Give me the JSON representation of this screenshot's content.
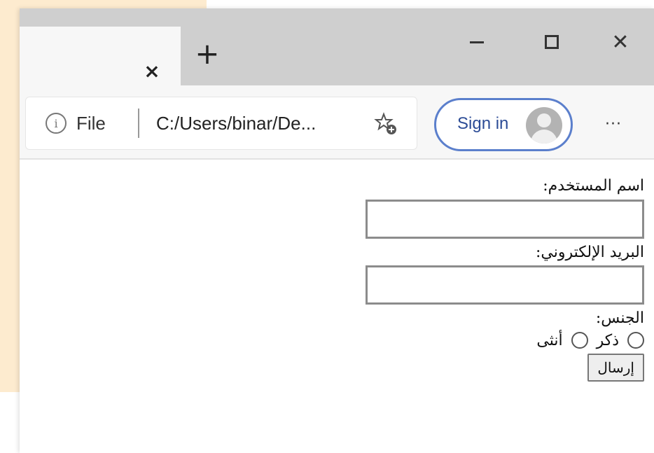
{
  "browser": {
    "tab": {
      "close_glyph": "×"
    },
    "new_tab_glyph": "+",
    "window_controls": {
      "minimize": "minimize-icon",
      "maximize": "maximize-icon",
      "close_glyph": "✕"
    },
    "address_bar": {
      "info_glyph": "i",
      "scheme_label": "File",
      "url": "C:/Users/binar/De..."
    },
    "favorites_icon": "star-add-icon",
    "sign_in_label": "Sign in",
    "more_glyph": "···"
  },
  "form": {
    "username_label": "اسم المستخدم:",
    "email_label": "البريد الإلكتروني:",
    "gender_label": "الجنس:",
    "gender_options": [
      "ذكر",
      "أنثى"
    ],
    "submit_label": "إرسال"
  },
  "colors": {
    "background_panel": "#fdebcf",
    "titlebar": "#cfcfcf",
    "toolbar": "#f7f7f7",
    "signin_border": "#5b7fcc"
  }
}
